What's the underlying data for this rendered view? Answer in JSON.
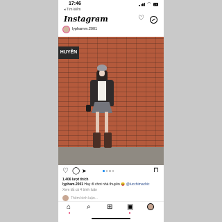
{
  "status": {
    "time": "17:46",
    "back_label": "◂ Tìm kiếm",
    "battery": "23"
  },
  "app": {
    "logo": "Instagram",
    "accent": "#1d8cf0"
  },
  "post": {
    "username": "lyphamm.2001",
    "sign_text": "HUYỀN",
    "likes": "1.406 lượt thích",
    "caption_user": "lypham.2001",
    "caption_text": " Hay đi chơi nhà thuyền ",
    "caption_emoji": "😝",
    "caption_tag": " @lucchimachic",
    "comments": "Xem tất cả 4 bình luận",
    "add_comment": "Thêm bình luận..."
  },
  "icons": {
    "heart": "♡",
    "comment": "◯",
    "share": "➤",
    "save": "⊓",
    "home": "⌂",
    "search": "⌕",
    "create": "⊞",
    "reels": "▣"
  }
}
